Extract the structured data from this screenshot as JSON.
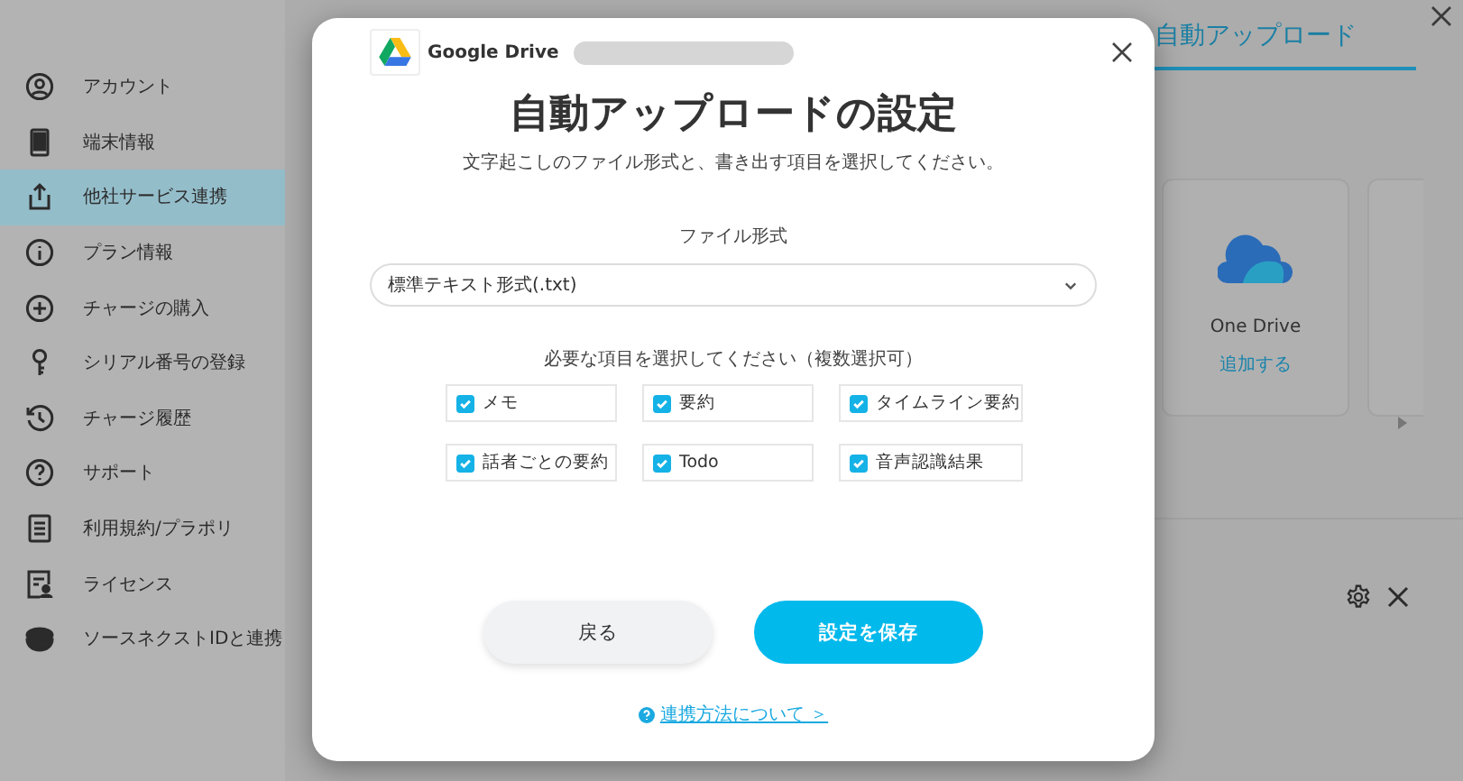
{
  "sidebar": {
    "items": [
      {
        "label": "アカウント",
        "selected": false
      },
      {
        "label": "端末情報",
        "selected": false
      },
      {
        "label": "他社サービス連携",
        "selected": true
      },
      {
        "label": "プラン情報",
        "selected": false
      },
      {
        "label": "チャージの購入",
        "selected": false
      },
      {
        "label": "シリアル番号の登録",
        "selected": false
      },
      {
        "label": "チャージ履歴",
        "selected": false
      },
      {
        "label": "サポート",
        "selected": false
      },
      {
        "label": "利用規約/プラポリ",
        "selected": false
      },
      {
        "label": "ライセンス",
        "selected": false
      },
      {
        "label": "ソースネクストIDと連携",
        "selected": false
      }
    ]
  },
  "background_page": {
    "tab": {
      "label": "自動アップロード",
      "selected": true
    },
    "service_card": {
      "name": "One Drive",
      "action": "追加する"
    }
  },
  "dialog": {
    "service": "Google Drive",
    "title": "自動アップロードの設定",
    "subtitle": "文字起こしのファイル形式と、書き出す項目を選択してください。",
    "file_format": {
      "label": "ファイル形式",
      "value": "標準テキスト形式(.txt)"
    },
    "items_label": "必要な項目を選択してください（複数選択可）",
    "items": [
      {
        "label": "メモ",
        "checked": true
      },
      {
        "label": "要約",
        "checked": true
      },
      {
        "label": "タイムライン要約",
        "checked": true
      },
      {
        "label": "話者ごとの要約",
        "checked": true
      },
      {
        "label": "Todo",
        "checked": true
      },
      {
        "label": "音声認識結果",
        "checked": true
      }
    ],
    "buttons": [
      {
        "label": "戻る",
        "kind": "secondary"
      },
      {
        "label": "設定を保存",
        "kind": "primary"
      }
    ],
    "help_link": "連携方法について ＞"
  }
}
